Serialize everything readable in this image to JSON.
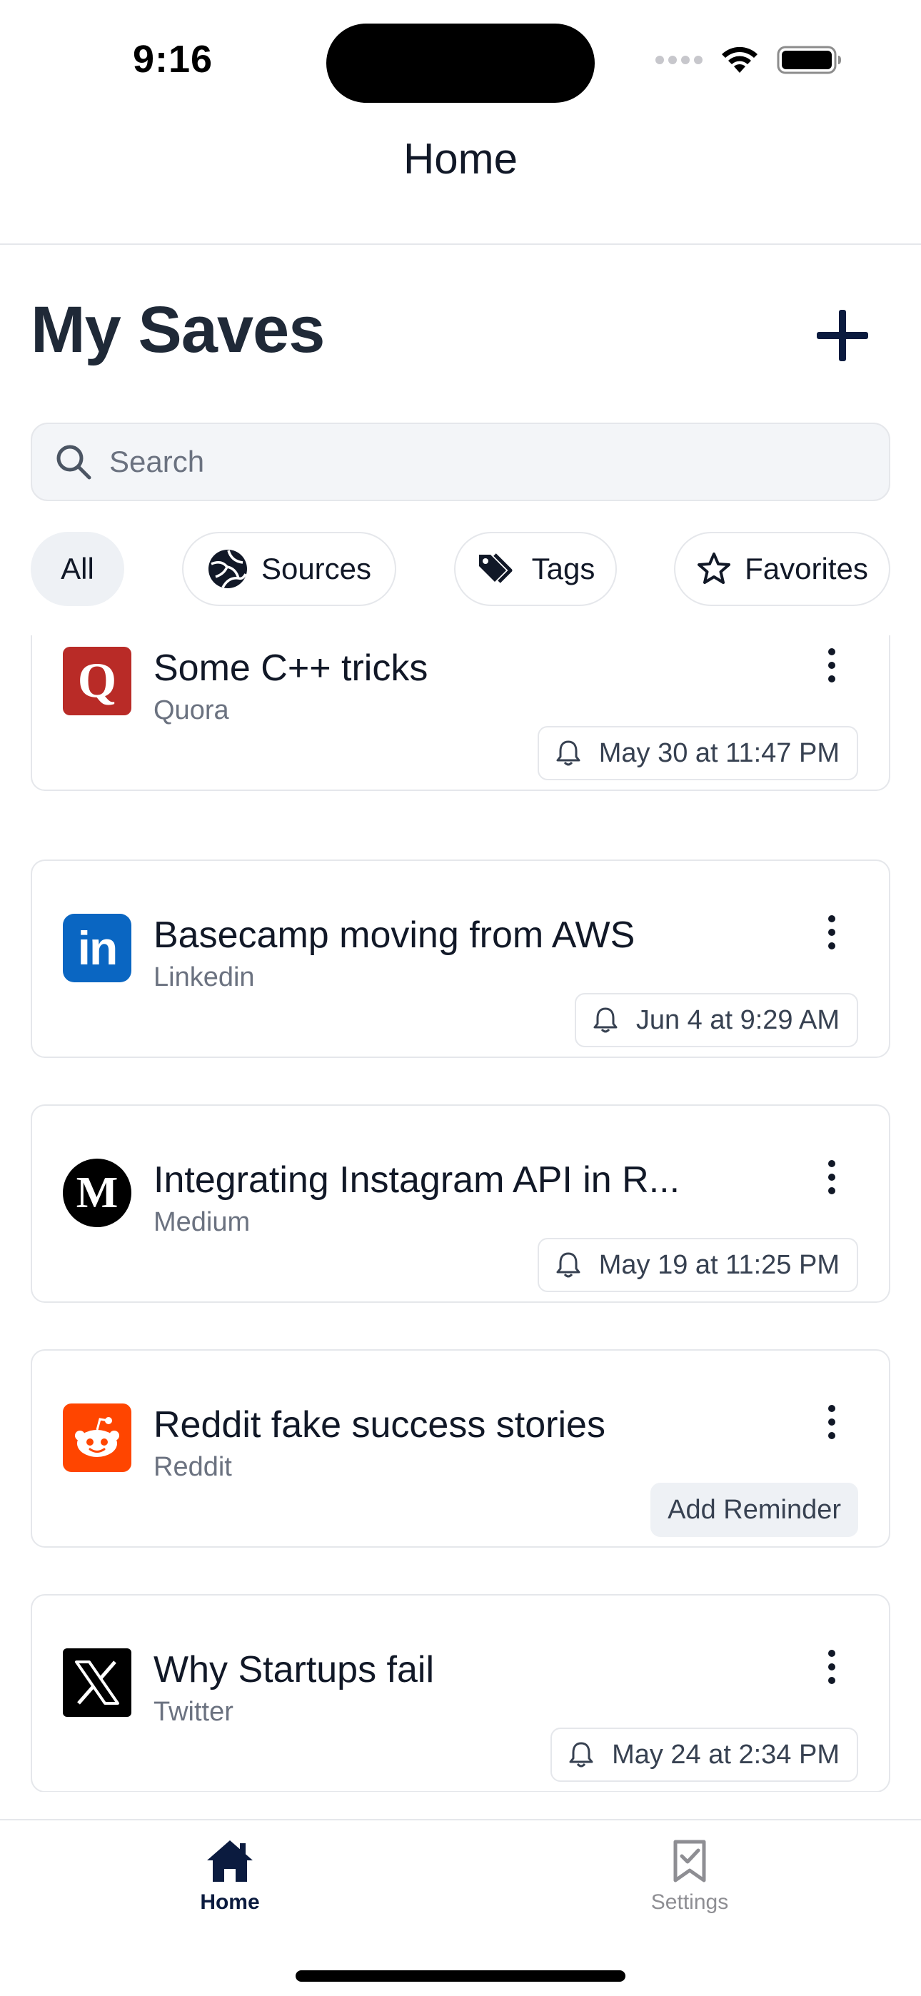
{
  "status_bar": {
    "time": "9:16"
  },
  "header": {
    "title": "Home"
  },
  "page": {
    "title": "My Saves"
  },
  "search": {
    "placeholder": "Search"
  },
  "filters": [
    {
      "label": "All",
      "icon": "none",
      "active": true
    },
    {
      "label": "Sources",
      "icon": "globe-icon",
      "active": false
    },
    {
      "label": "Tags",
      "icon": "tags-icon",
      "active": false
    },
    {
      "label": "Favorites",
      "icon": "star-icon",
      "active": false
    }
  ],
  "saves": [
    {
      "title": "Some C++ tricks",
      "source": "Quora",
      "logo": "quora-logo",
      "logo_color": "#b92b27",
      "reminder": "May 30 at 11:47 PM",
      "reminder_type": "set"
    },
    {
      "title": "Basecamp moving from AWS",
      "source": "Linkedin",
      "logo": "linkedin-logo",
      "logo_color": "#0a66c2",
      "reminder": "Jun 4 at 9:29 AM",
      "reminder_type": "set"
    },
    {
      "title": "Integrating Instagram API in R...",
      "source": "Medium",
      "logo": "medium-logo",
      "logo_color": "#000000",
      "reminder": "May 19 at 11:25 PM",
      "reminder_type": "set"
    },
    {
      "title": "Reddit fake success stories",
      "source": "Reddit",
      "logo": "reddit-logo",
      "logo_color": "#ff4500",
      "reminder": "Add Reminder",
      "reminder_type": "add"
    },
    {
      "title": "Why Startups fail",
      "source": "Twitter",
      "logo": "x-logo",
      "logo_color": "#000000",
      "reminder": "May 24 at 2:34 PM",
      "reminder_type": "set"
    }
  ],
  "tab_bar": {
    "home_label": "Home",
    "settings_label": "Settings",
    "active_color": "#0b1b3f",
    "inactive_color": "#8e8e93"
  }
}
